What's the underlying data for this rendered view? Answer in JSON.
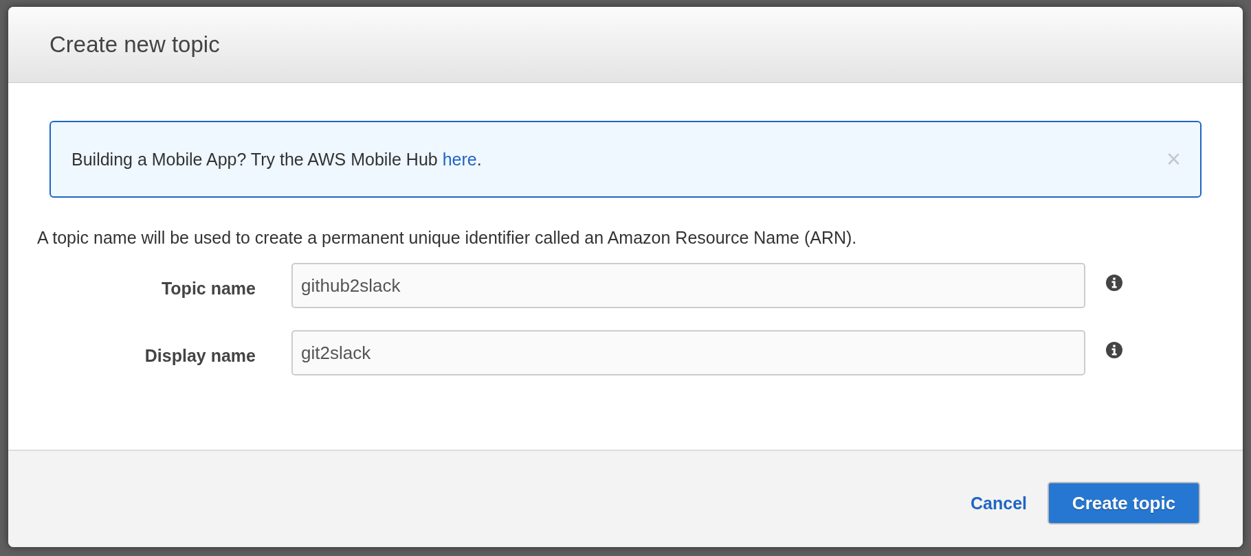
{
  "dialog": {
    "title": "Create new topic",
    "notice": {
      "text": "Building a Mobile App? Try the AWS Mobile Hub ",
      "link": "here",
      "after": ".",
      "close": "×"
    },
    "description": "A topic name will be used to create a permanent unique identifier called an Amazon Resource Name (ARN).",
    "fields": [
      {
        "label": "Topic name",
        "value": "github2slack"
      },
      {
        "label": "Display name",
        "value": "git2slack"
      }
    ],
    "buttons": [
      {
        "label": "Cancel",
        "kind": "link"
      },
      {
        "label": "Create topic",
        "kind": "primary"
      }
    ]
  }
}
